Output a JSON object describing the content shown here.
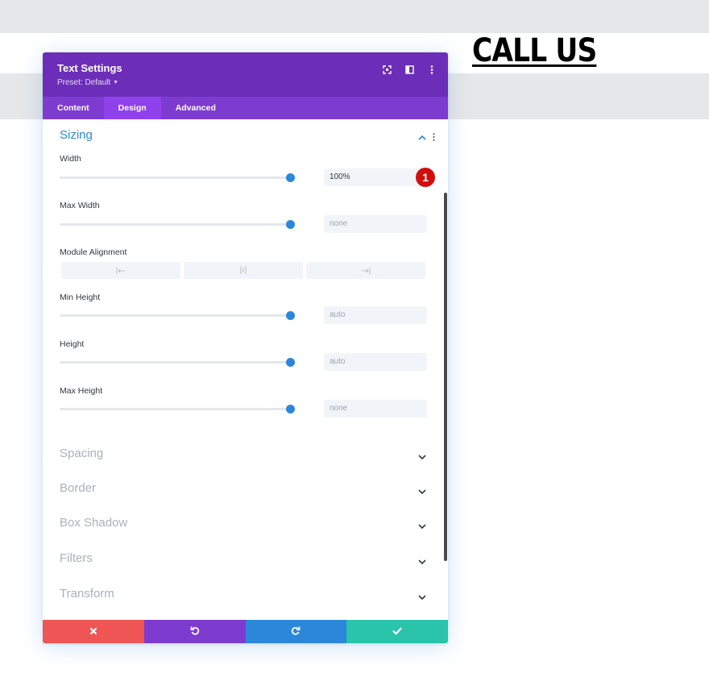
{
  "page": {
    "heading": "CALL US"
  },
  "modal": {
    "title": "Text Settings",
    "preset": "Preset: Default",
    "header_icons": [
      "expand-icon",
      "split-view-icon",
      "more-vertical-icon"
    ]
  },
  "tabs": [
    {
      "label": "Content",
      "active": false
    },
    {
      "label": "Design",
      "active": true
    },
    {
      "label": "Advanced",
      "active": false
    }
  ],
  "sizing": {
    "title": "Sizing",
    "fields": [
      {
        "label": "Width",
        "value": "100%",
        "is_placeholder": false,
        "slider_percent": 100
      },
      {
        "label": "Max Width",
        "value": "none",
        "is_placeholder": true,
        "slider_percent": 100
      },
      {
        "label": "Min Height",
        "value": "auto",
        "is_placeholder": true,
        "slider_percent": 100
      },
      {
        "label": "Height",
        "value": "auto",
        "is_placeholder": true,
        "slider_percent": 100
      },
      {
        "label": "Max Height",
        "value": "none",
        "is_placeholder": true,
        "slider_percent": 100
      }
    ],
    "module_alignment": {
      "label": "Module Alignment",
      "options": [
        "align-left-icon",
        "align-center-icon",
        "align-right-icon"
      ]
    },
    "badge": "1"
  },
  "collapsed_sections": [
    "Spacing",
    "Border",
    "Box Shadow",
    "Filters",
    "Transform"
  ],
  "footer": {
    "buttons": [
      {
        "name": "discard",
        "icon": "close-icon",
        "color": "#ef5555"
      },
      {
        "name": "undo",
        "icon": "undo-icon",
        "color": "#7e3bd0"
      },
      {
        "name": "redo",
        "icon": "redo-icon",
        "color": "#2b87da"
      },
      {
        "name": "save",
        "icon": "check-icon",
        "color": "#29c4a9"
      }
    ]
  },
  "colors": {
    "header": "#6c2eb9",
    "tabs": "#7e3bd0",
    "active_tab": "#8f42ec",
    "accent": "#2b87da",
    "badge": "#d10e0e"
  }
}
